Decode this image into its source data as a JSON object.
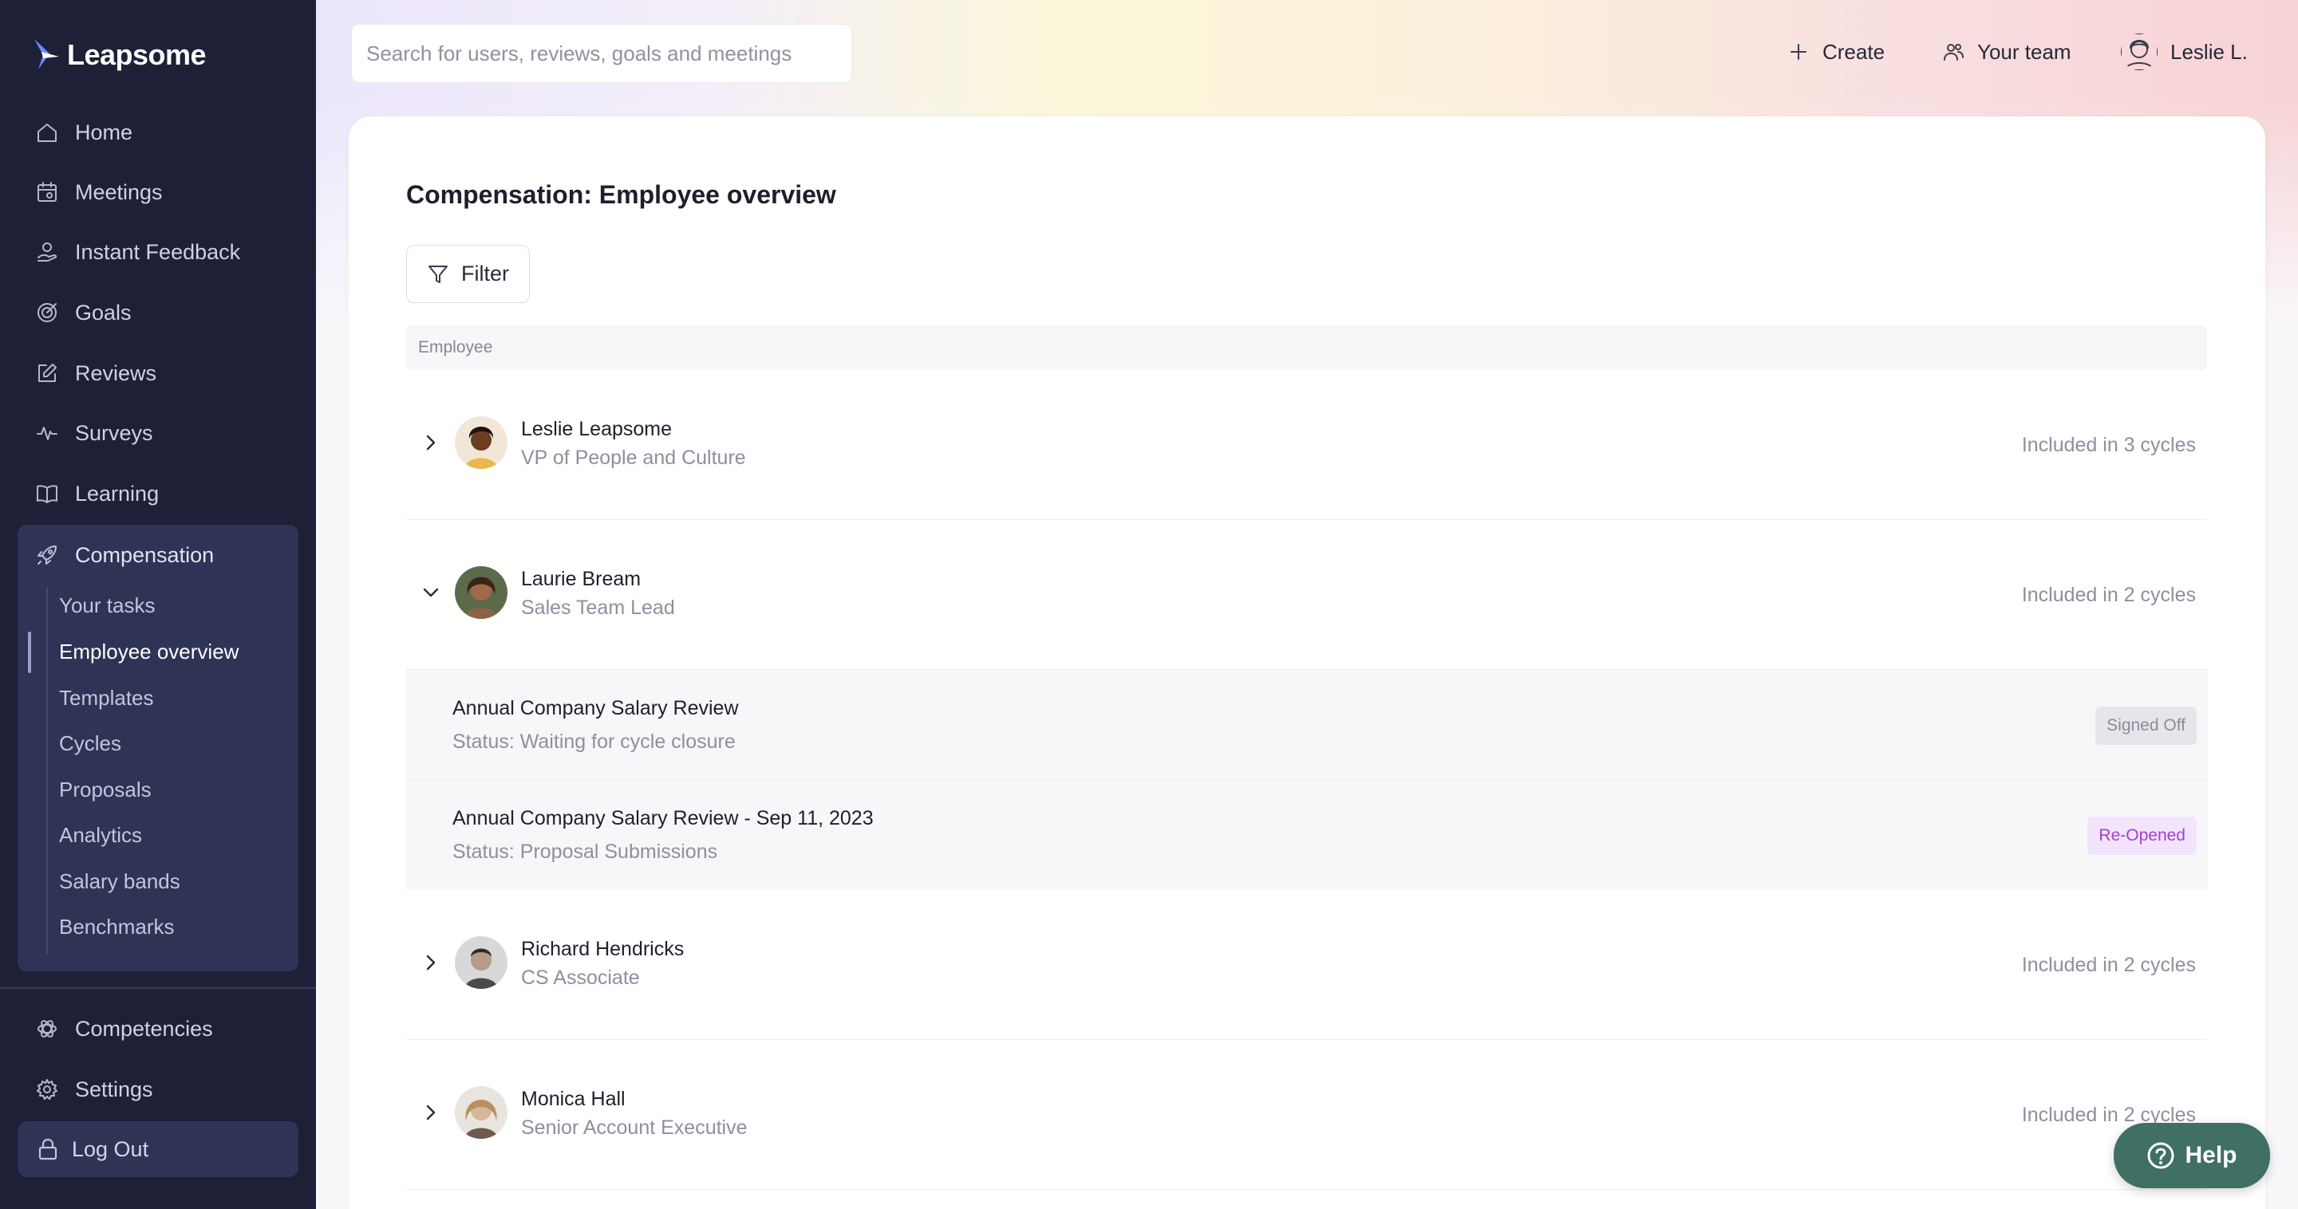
{
  "brand": {
    "name": "Leapsome",
    "accent": "#1e2038"
  },
  "sidebar": {
    "items": [
      {
        "label": "Home",
        "icon": "home-icon"
      },
      {
        "label": "Meetings",
        "icon": "calendar-icon"
      },
      {
        "label": "Instant Feedback",
        "icon": "feedback-icon"
      },
      {
        "label": "Goals",
        "icon": "target-icon"
      },
      {
        "label": "Reviews",
        "icon": "edit-icon"
      },
      {
        "label": "Surveys",
        "icon": "pulse-icon"
      },
      {
        "label": "Learning",
        "icon": "book-icon"
      }
    ],
    "compensation": {
      "label": "Compensation",
      "icon": "rocket-icon",
      "sub_items": [
        "Your tasks",
        "Employee overview",
        "Templates",
        "Cycles",
        "Proposals",
        "Analytics",
        "Salary bands",
        "Benchmarks"
      ],
      "active": "Employee overview"
    },
    "bottom_items": [
      {
        "label": "Competencies",
        "icon": "atom-icon"
      },
      {
        "label": "Settings",
        "icon": "gear-icon"
      }
    ],
    "logout": "Log Out"
  },
  "header": {
    "search_placeholder": "Search for users, reviews, goals and meetings",
    "create": "Create",
    "your_team": "Your team",
    "user": "Leslie L."
  },
  "main": {
    "title": "Compensation: Employee overview",
    "filter": "Filter",
    "column_employee": "Employee",
    "rows": [
      {
        "name": "Leslie Leapsome",
        "role": "VP of People and Culture",
        "cycles": "Included in 3 cycles",
        "expanded": false
      },
      {
        "name": "Laurie Bream",
        "role": "Sales Team Lead",
        "cycles": "Included in 2 cycles",
        "expanded": true
      },
      {
        "name": "Richard Hendricks",
        "role": "CS Associate",
        "cycles": "Included in 2 cycles",
        "expanded": false
      },
      {
        "name": "Monica Hall",
        "role": "Senior Account Executive",
        "cycles": "Included in 2 cycles",
        "expanded": false
      }
    ],
    "expanded_cycles": [
      {
        "title": "Annual Company Salary Review",
        "status": "Status: Waiting for cycle closure",
        "badge": "Signed Off"
      },
      {
        "title": "Annual Company Salary Review - Sep 11, 2023",
        "status": "Status: Proposal Submissions",
        "badge": "Re-Opened"
      }
    ]
  },
  "help": "Help"
}
